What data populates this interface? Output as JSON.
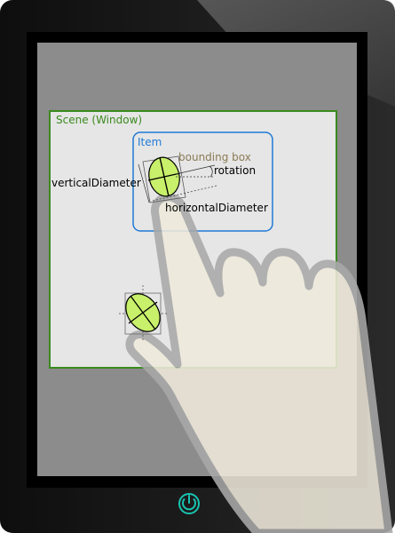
{
  "scene": {
    "label": "Scene (Window)",
    "border_color": "#3a8a1e",
    "label_color": "#3a8a1e"
  },
  "item": {
    "label": "Item",
    "border_color": "#1f7ad6",
    "label_color": "#1f7ad6"
  },
  "annotations": {
    "bounding_box": "bounding box",
    "rotation": "rotation",
    "vertical_diameter": "verticalDiameter",
    "horizontal_diameter": "horizontalDiameter"
  },
  "colors": {
    "touch_point_fill": "#c8f06a",
    "bounding_box_label": "#8a7a55",
    "power_icon": "#19c3b0",
    "tablet_body": "#1a1a1a",
    "screen": "#8c8c8c",
    "hand": "#efeadb"
  },
  "icons": {
    "power": "power-icon",
    "hand": "pointing-hand"
  }
}
